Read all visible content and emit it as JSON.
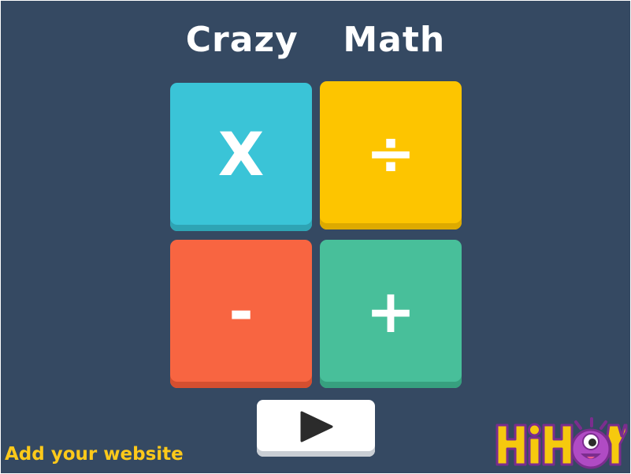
{
  "game": {
    "title": "Crazy  Math"
  },
  "operations": {
    "multiply": {
      "symbol": "X",
      "color": "#3ac4d7"
    },
    "divide": {
      "symbol": "÷",
      "color": "#fdc500"
    },
    "subtract": {
      "symbol": "-",
      "color": "#f86541"
    },
    "add": {
      "symbol": "+",
      "color": "#48bf9a"
    }
  },
  "controls": {
    "play_icon": "play-icon"
  },
  "footer": {
    "website_text": "Add your website",
    "website_color": "#fdc91a",
    "logo_text": "HiHoY"
  },
  "colors": {
    "background": "#354962"
  }
}
